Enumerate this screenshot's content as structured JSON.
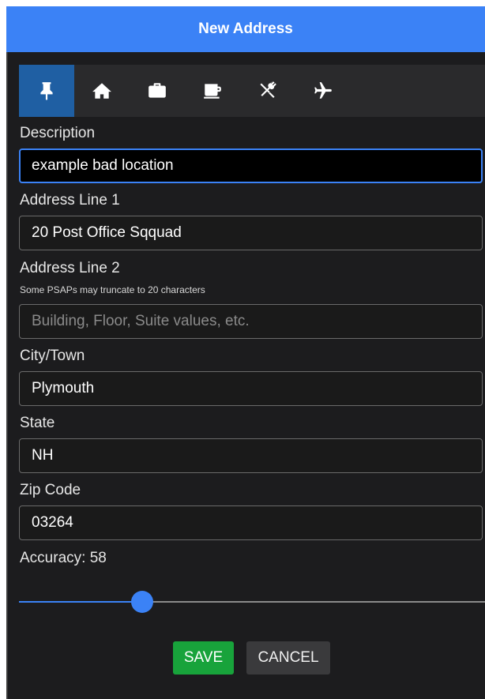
{
  "dialog": {
    "title": "New Address"
  },
  "icon_bar": {
    "selected": "pin",
    "icons": [
      {
        "name": "pin-icon"
      },
      {
        "name": "home-icon"
      },
      {
        "name": "briefcase-icon"
      },
      {
        "name": "coffee-icon"
      },
      {
        "name": "restaurant-icon"
      },
      {
        "name": "airplane-icon"
      }
    ]
  },
  "form": {
    "description": {
      "label": "Description",
      "value": "example bad location"
    },
    "address1": {
      "label": "Address Line 1",
      "value": "20 Post Office Sqquad"
    },
    "address2": {
      "label": "Address Line 2",
      "hint": "Some PSAPs may truncate to 20 characters",
      "value": "",
      "placeholder": "Building, Floor, Suite values, etc."
    },
    "city": {
      "label": "City/Town",
      "value": "Plymouth"
    },
    "state": {
      "label": "State",
      "value": "NH"
    },
    "zip": {
      "label": "Zip Code",
      "value": "03264"
    },
    "accuracy": {
      "label": "Accuracy: 58",
      "value": 58,
      "fraction": 0.265
    }
  },
  "buttons": {
    "save": "SAVE",
    "cancel": "CANCEL"
  },
  "colors": {
    "accent": "#3b82f6",
    "save": "#18a33b",
    "background": "#1c1c1e"
  }
}
